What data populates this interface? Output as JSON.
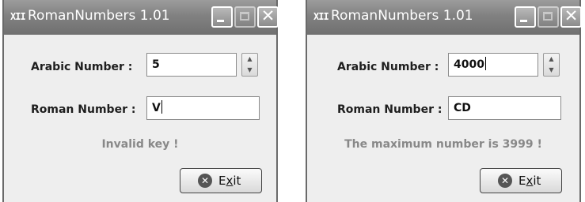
{
  "windows": [
    {
      "title": "RomanNumbers 1.01",
      "app_icon": "XII",
      "arabic_label": "Arabic Number :",
      "arabic_value": "5",
      "roman_label": "Roman Number :",
      "roman_value": "V",
      "message": "Invalid key !",
      "exit_pre": "E",
      "exit_ul": "x",
      "exit_post": "it"
    },
    {
      "title": "RomanNumbers 1.01",
      "app_icon": "XII",
      "arabic_label": "Arabic Number :",
      "arabic_value": "4000",
      "roman_label": "Roman Number :",
      "roman_value": "CD",
      "message": "The maximum number is 3999 !",
      "exit_pre": "E",
      "exit_ul": "x",
      "exit_post": "it"
    }
  ],
  "icons": {
    "close": "✕",
    "exit": "✕",
    "spin_up": "▲",
    "spin_down": "▼"
  },
  "colors": {
    "titlebar": "#818181",
    "window_bg": "#eeeeee",
    "message": "#888888"
  }
}
